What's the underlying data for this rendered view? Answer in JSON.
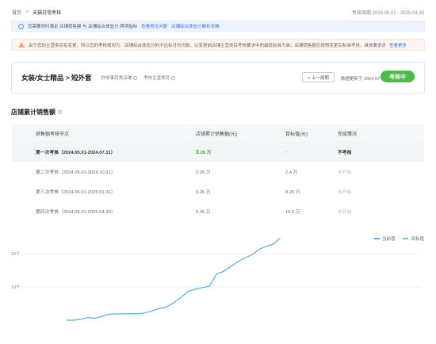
{
  "breadcrumb": {
    "home": "首页",
    "sep": ">",
    "current": "天猫日常考核"
  },
  "period": {
    "label": "考核周期",
    "value": "2024.05.01 - 2025.04.30"
  },
  "notice_blue": {
    "text": "您需要同时满足 店铺销售额 与 店铺综合体验分 两项指标",
    "link1": "查看常见问题",
    "link2": "店铺综合体验分解析攻略"
  },
  "notice_orange": {
    "text": "由于您的主营类目有变更，所以您的考核规则为：店铺综合体验分的不达标月份次数，以变更前店铺主营类目考核要求中的最低标准为准；店铺销售额仍按照变更后标准考核，具体要求请查看考核规则说明",
    "link": "查看更多"
  },
  "shop": {
    "name": "女装/女士精品 > 短外套",
    "tag1": "你非事后类店铺",
    "tag2": "考核主营类目",
    "prev_label": "< 上一周期",
    "update_label": "数据更新于 2024-07-02",
    "status": "考核中"
  },
  "sales": {
    "title": "店铺累计销售额",
    "headers": [
      "销售额考核节点",
      "店铺累计销售额(元)",
      "目标值(元)",
      "完成情况"
    ],
    "rows": [
      {
        "node": "第一次考核（2024.05.01-2024.07.31）",
        "sales_num": "3",
        "sales_rest": ".26 万",
        "target": "-",
        "status": "不考核"
      },
      {
        "node": "第二次考核（2024.05.01-2024.10.31）",
        "sales": "3.26 万",
        "target": "2.4 万",
        "status": "未开启"
      },
      {
        "node": "第三次考核（2024.05.01-2025.01.31）",
        "sales": "3.26 万",
        "target": "8.25 万",
        "status": "未开启"
      },
      {
        "node": "第四次考核（2024.05.01-2025.04.30）",
        "sales": "3.26 万",
        "target": "16.5 万",
        "status": "未开启"
      }
    ]
  },
  "legend": {
    "current": "当前值",
    "target": "目标值"
  },
  "colors": {
    "accent": "#4cbb4a",
    "link": "#3b6fe0",
    "line": "#5aa9e6"
  },
  "chart_data": {
    "type": "line",
    "title": "",
    "y_ticks": [
      "30千",
      "20千",
      "10千"
    ],
    "ylim": [
      0,
      35000
    ],
    "series": [
      {
        "name": "当前值",
        "values": [
          0,
          0,
          300,
          800,
          600,
          1200,
          1800,
          1900,
          1900,
          2000,
          1900,
          2200,
          2800,
          3500,
          4000,
          5200,
          6800,
          8600,
          9300,
          9800,
          10200,
          13800,
          14700,
          16100,
          17600,
          18700,
          19700,
          21300,
          22200,
          22900,
          24900,
          25000,
          27800,
          28800,
          29800,
          30600,
          30900,
          30900,
          31100,
          31100,
          31200,
          31200,
          31300,
          31300,
          31400,
          31500,
          31600,
          32000,
          32500,
          32600
        ]
      }
    ]
  }
}
